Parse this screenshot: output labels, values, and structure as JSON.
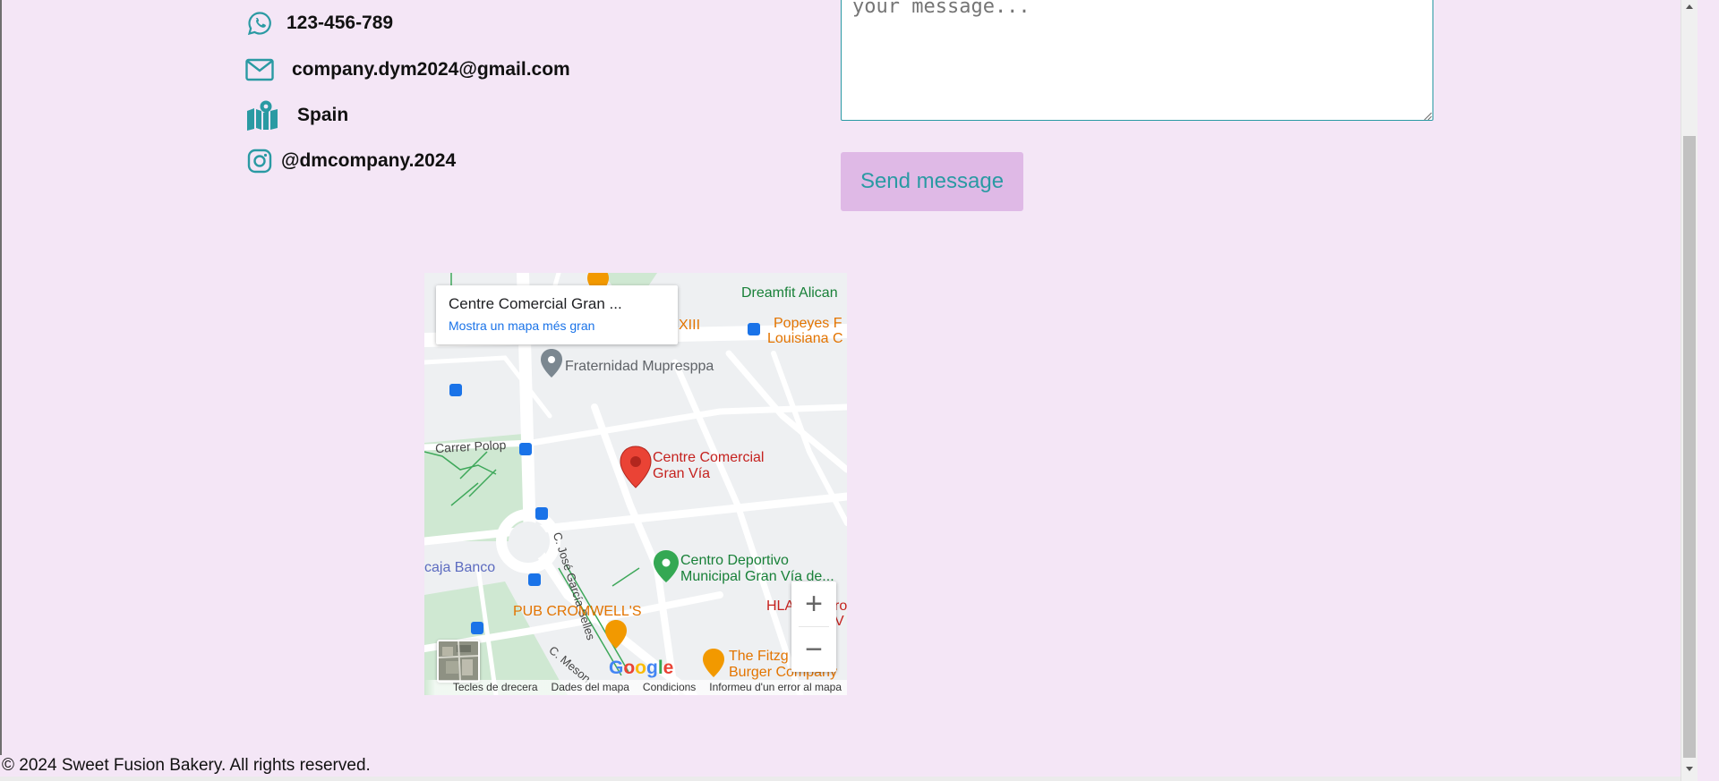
{
  "contact": {
    "phone": "123-456-789",
    "email": "company.dym2024@gmail.com",
    "location": "Spain",
    "instagram": "@dmcompany.2024"
  },
  "form": {
    "message_placeholder": "your message...",
    "send_label": "Send message"
  },
  "map": {
    "place_title": "Centre Comercial Gran ...",
    "bigger_map_link": "Mostra un mapa més gran",
    "labels": {
      "dreamfit": "Dreamfit Alican",
      "popeyes_1": "Popeyes F",
      "popeyes_2": "Louisiana C",
      "xiii": "XIII",
      "fraternidad": "Fraternidad Mupresppa",
      "carrer_polop": "Carrer Polop",
      "gran_via_1": "Centre Comercial",
      "gran_via_2": "Gran Vía",
      "jose_garcia": "C. José García Selles",
      "centro_deportivo_1": "Centro Deportivo",
      "centro_deportivo_2": "Municipal Gran Vía de...",
      "caja_banco": "caja Banco",
      "pub": "PUB CROMWELL'S",
      "hla_1": "HLA",
      "hla_2": "ro",
      "hla_3": "V",
      "c_meson": "C. Meson",
      "fitzg_1": "The Fitzg",
      "fitzg_2": "Burger Company"
    },
    "zoom_in": "+",
    "zoom_out": "−",
    "google": "Google",
    "attribution": {
      "shortcuts": "Tecles de drecera",
      "map_data": "Dades del mapa",
      "terms": "Condicions",
      "report": "Informeu d'un error al mapa"
    }
  },
  "footer": {
    "text": "© 2024 Sweet Fusion Bakery. All rights reserved."
  },
  "colors": {
    "background": "#f4e6f6",
    "accent_teal": "#2a9aa3",
    "button_bg": "#dfb9e6",
    "map_pin": "#ea4335"
  }
}
